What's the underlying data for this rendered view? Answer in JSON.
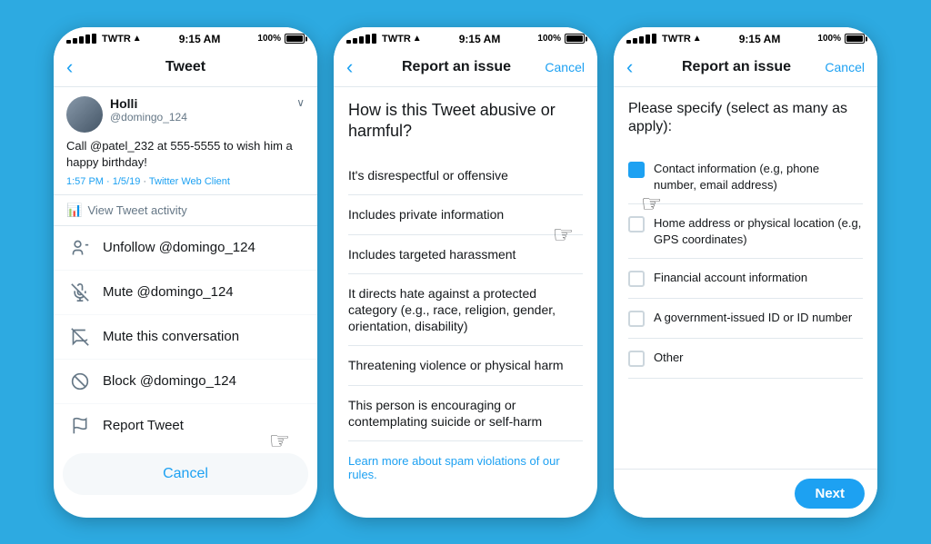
{
  "background_color": "#2DAAE1",
  "phones": [
    {
      "id": "phone1",
      "status_bar": {
        "dots": "●●●●●",
        "carrier": "TWTR",
        "wifi": "wifi",
        "time": "9:15 AM",
        "battery_pct": "100%",
        "battery_full": true
      },
      "nav": {
        "title": "Tweet",
        "back_label": "‹",
        "has_cancel": false
      },
      "tweet": {
        "name": "Holli",
        "handle": "@domingo_124",
        "text": "Call @patel_232 at 555-5555 to wish him a happy birthday!",
        "time": "1:57 PM · 1/5/19",
        "client": "Twitter Web Client"
      },
      "activity": "View Tweet activity",
      "menu_items": [
        {
          "icon": "👤",
          "label": "Unfollow @domingo_124"
        },
        {
          "icon": "🔕",
          "label": "Mute @domingo_124"
        },
        {
          "icon": "🔕",
          "label": "Mute this conversation"
        },
        {
          "icon": "🚫",
          "label": "Block @domingo_124"
        },
        {
          "icon": "⚑",
          "label": "Report Tweet",
          "has_cursor": true
        }
      ],
      "cancel_label": "Cancel"
    },
    {
      "id": "phone2",
      "status_bar": {
        "dots": "●●●●●",
        "carrier": "TWTR",
        "wifi": "wifi",
        "time": "9:15 AM",
        "battery_pct": "100%",
        "battery_full": true
      },
      "nav": {
        "title": "Report an issue",
        "back_label": "‹",
        "has_cancel": true,
        "cancel_label": "Cancel"
      },
      "question": "How is this Tweet abusive or harmful?",
      "options": [
        "It's disrespectful or offensive",
        "Includes private information",
        "Includes targeted harassment",
        "It directs hate against a protected category (e.g., race, religion, gender, orientation, disability)",
        "Threatening violence or physical harm",
        "This person is encouraging or contemplating suicide or self-harm"
      ],
      "footer": "Learn more about spam violations of our rules.",
      "footer_link": "Learn more",
      "cursor_on_option": 1
    },
    {
      "id": "phone3",
      "status_bar": {
        "dots": "●●●●●",
        "carrier": "TWTR",
        "wifi": "wifi",
        "time": "9:15 AM",
        "battery_pct": "100%",
        "battery_full": true
      },
      "nav": {
        "title": "Report an issue",
        "back_label": "‹",
        "has_cancel": true,
        "cancel_label": "Cancel"
      },
      "title": "Please specify (select as many as apply):",
      "options": [
        {
          "label": "Contact information (e.g, phone number, email address)",
          "selected": true
        },
        {
          "label": "Home address or physical location (e.g, GPS coordinates)",
          "selected": false
        },
        {
          "label": "Financial account information",
          "selected": false
        },
        {
          "label": "A government-issued ID or ID number",
          "selected": false
        },
        {
          "label": "Other",
          "selected": false
        }
      ],
      "next_label": "Next",
      "cursor_on_option": 0
    }
  ]
}
